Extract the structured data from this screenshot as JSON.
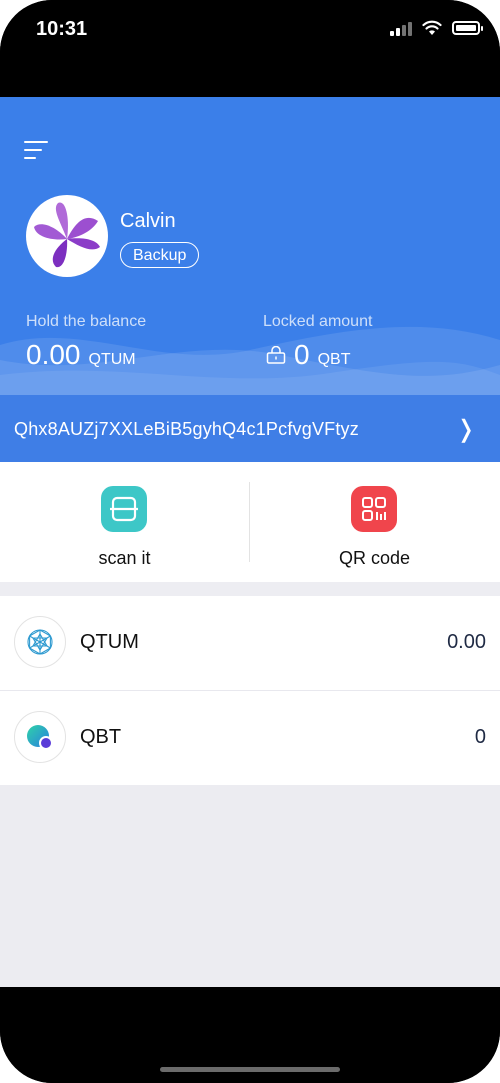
{
  "status_bar": {
    "time": "10:31"
  },
  "wallet": {
    "username": "Calvin",
    "backup_label": "Backup",
    "balance_label": "Hold the balance",
    "balance_value": "0.00",
    "balance_unit": "QTUM",
    "locked_label": "Locked amount",
    "locked_value": "0",
    "locked_unit": "QBT",
    "address": "Qhx8AUZj7XXLeBiB5gyhQ4c1PcfvgVFtyz",
    "chevron": "❭"
  },
  "actions": {
    "scan_label": "scan it",
    "qr_label": "QR code",
    "scan_color": "#3dc7c7",
    "qr_color": "#f0454c"
  },
  "tokens": [
    {
      "name": "QTUM",
      "balance": "0.00",
      "icon": "qtum-icon"
    },
    {
      "name": "QBT",
      "balance": "0",
      "icon": "qbt-icon"
    }
  ],
  "colors": {
    "header": "#3b7fe9",
    "address_bar": "#3f7ee6"
  }
}
